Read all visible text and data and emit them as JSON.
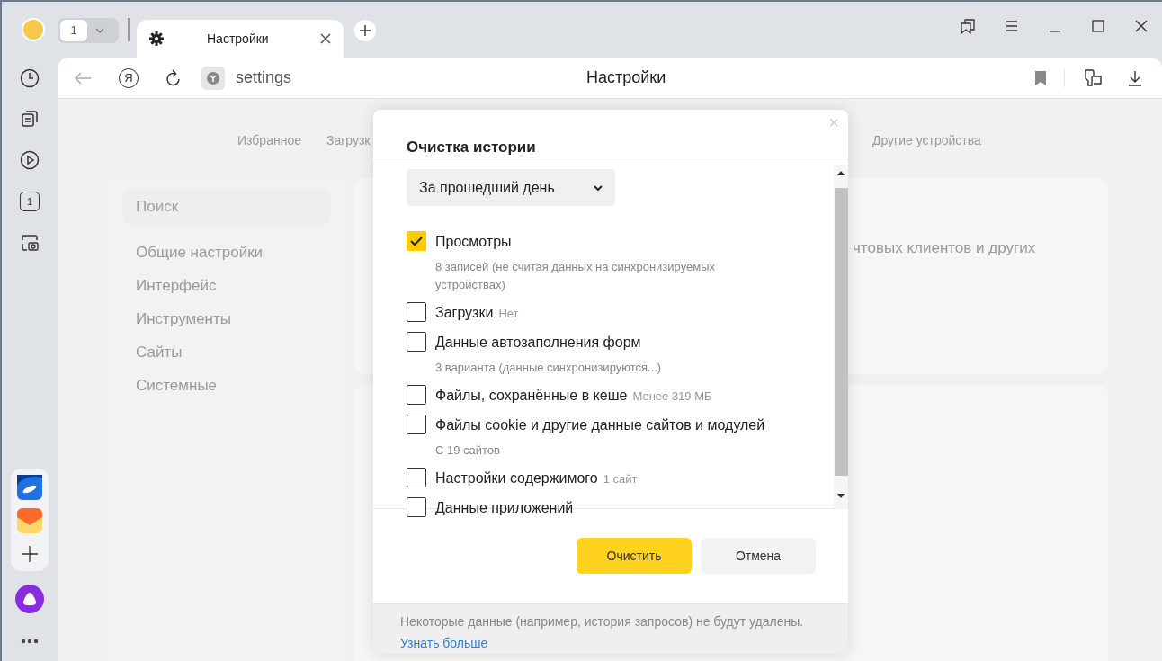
{
  "tab_strip": {
    "tab_counter": "1",
    "tabs": [
      {
        "title": "Настройки",
        "selected": true
      }
    ]
  },
  "address_bar": {
    "yandex_button": "Я",
    "url": "settings",
    "page_title": "Настройки"
  },
  "sidebar": {
    "tab_counter": "1"
  },
  "settings_page": {
    "nav_links": [
      "Избранное",
      "Загрузк",
      "Другие устройства"
    ],
    "search": {
      "placeholder": "Поиск"
    },
    "menu": [
      "Общие настройки",
      "Интерфейс",
      "Инструменты",
      "Сайты",
      "Системные"
    ],
    "card_text": "чтовых клиентов и других"
  },
  "dialog": {
    "title": "Очистка истории",
    "close": "×",
    "period": "За прошедший день",
    "items": [
      {
        "label": "Просмотры",
        "checked": true,
        "details": "8 записей (не считая данных на синхронизируемых устройствах)"
      },
      {
        "label": "Загрузки",
        "checked": false,
        "note": "Нет"
      },
      {
        "label": "Данные автозаполнения форм",
        "checked": false,
        "details": "3 варианта (данные синхронизируются...)"
      },
      {
        "label": "Файлы, сохранённые в кеше",
        "checked": false,
        "note": "Менее 319 МБ"
      },
      {
        "label": "Файлы cookie и другие данные сайтов и модулей",
        "checked": false,
        "details": "С 19 сайтов"
      },
      {
        "label": "Настройки содержимого",
        "checked": false,
        "note": "1 сайт"
      },
      {
        "label": "Данные приложений",
        "checked": false
      }
    ],
    "buttons": [
      {
        "label": "Очистить",
        "kind": "primary"
      },
      {
        "label": "Отмена",
        "kind": "secondary"
      }
    ],
    "footer": {
      "text": "Некоторые данные (например, история запросов) не будут удалены.",
      "link": "Узнать больше"
    }
  }
}
